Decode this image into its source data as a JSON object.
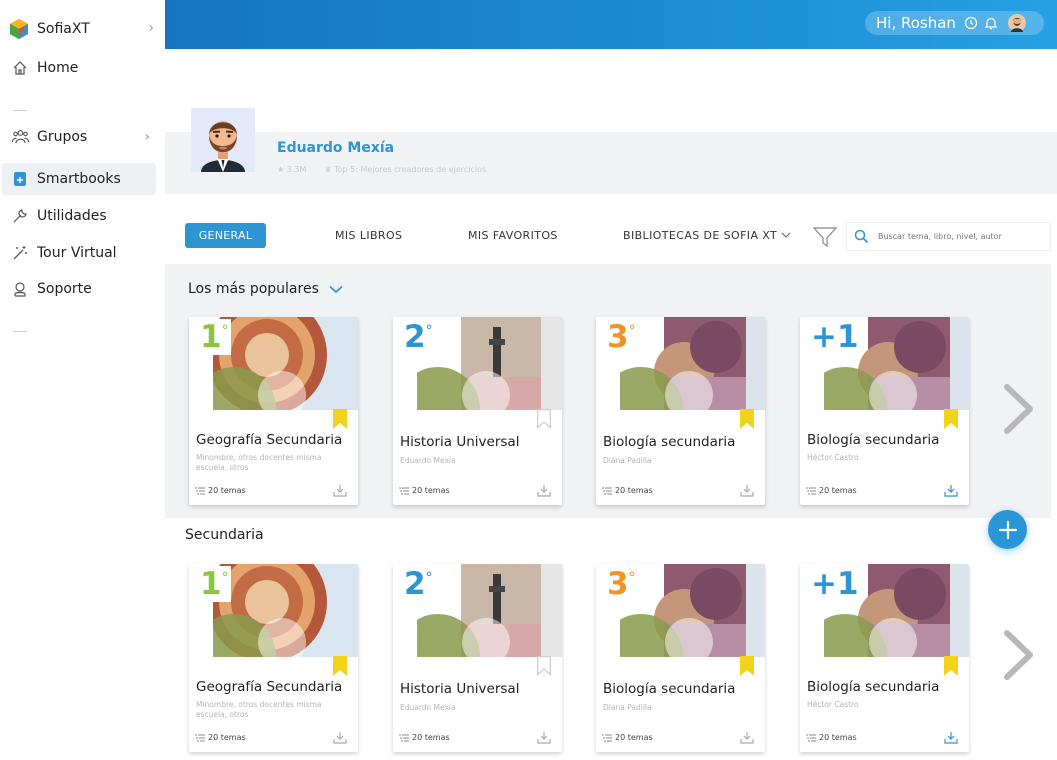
{
  "brand": {
    "name": "SofiaXT"
  },
  "sidebar": {
    "items": [
      {
        "label": "Home"
      },
      {
        "label": "Grupos"
      },
      {
        "label": "Smartbooks"
      },
      {
        "label": "Utilidades"
      },
      {
        "label": "Tour Virtual"
      },
      {
        "label": "Soporte"
      }
    ]
  },
  "header": {
    "greeting": "Hi, Roshan"
  },
  "profile": {
    "name": "Eduardo Mexía",
    "followers": "3.3M",
    "badge": "Top 5: Mejores creadores de ejercicios"
  },
  "tabs": {
    "general": "GENERAL",
    "mis_libros": "MIS LIBROS",
    "mis_favoritos": "MIS FAVORITOS",
    "bibliotecas": "BIBLIOTECAS DE SOFIA XT"
  },
  "search": {
    "placeholder": "Buscar tema, libro, nivel, autor"
  },
  "sections": {
    "popular": {
      "title": "Los más populares"
    },
    "secundaria": {
      "title": "Secundaria"
    }
  },
  "books": [
    {
      "grade": "1",
      "grade_sup": "°",
      "grade_color": "#8cc63f",
      "title": "Geografía Secundaria",
      "author": "Minombre, otros docentes misma escuela, otros",
      "topics": "20 temas",
      "bookmarked": true,
      "downloaded": false
    },
    {
      "grade": "2",
      "grade_sup": "°",
      "grade_color": "#2e95d3",
      "title": "Historia Universal",
      "author": "Eduardo Mexía",
      "topics": "20 temas",
      "bookmarked": false,
      "downloaded": false
    },
    {
      "grade": "3",
      "grade_sup": "°",
      "grade_color": "#f39224",
      "title": "Biología secundaria",
      "author": "Diana Padilla",
      "topics": "20 temas",
      "bookmarked": true,
      "downloaded": false
    },
    {
      "grade": "+1",
      "grade_sup": "",
      "grade_color": "#2e95d3",
      "title": "Biología secundaria",
      "author": "Héctor Castro",
      "topics": "20 temas",
      "bookmarked": true,
      "downloaded": true
    }
  ],
  "colors": {
    "accent": "#2e95d3",
    "bookmark": "#f2d21b",
    "header_start": "#1575c2",
    "header_end": "#27a0e4"
  }
}
